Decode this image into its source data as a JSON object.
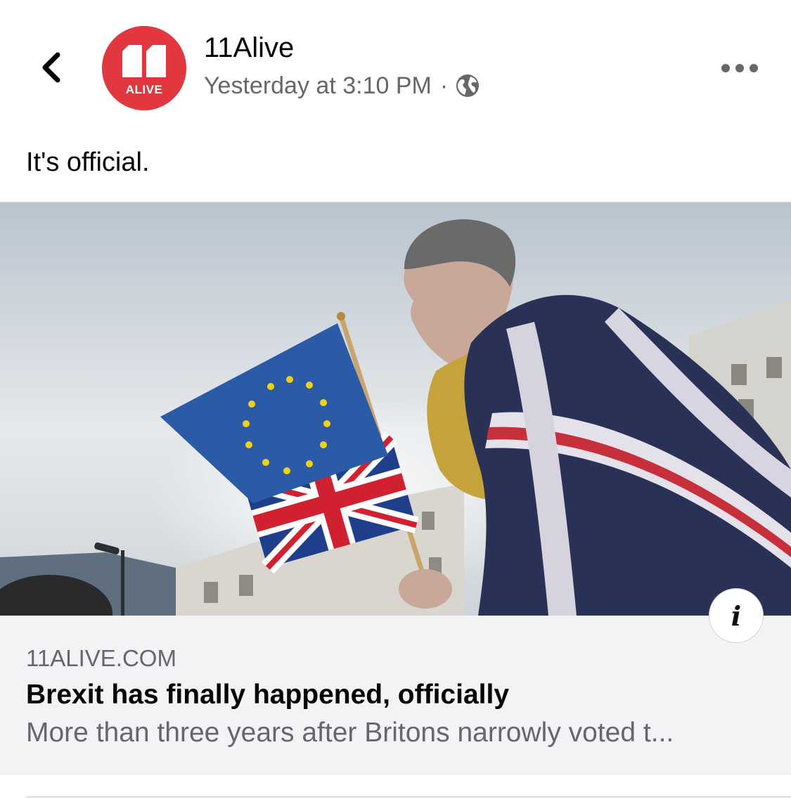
{
  "post": {
    "author": "11Alive",
    "timestamp": "Yesterday at 3:10 PM",
    "separator": "·",
    "privacy_icon": "globe-icon",
    "text": "It's official."
  },
  "avatar": {
    "logo_text": "ALIVE",
    "brand_color": "#e0383e"
  },
  "link_preview": {
    "domain": "11ALIVE.COM",
    "headline": "Brexit has finally happened, officially",
    "description": "More than three years after Britons narrowly voted t...",
    "info_label": "i"
  },
  "icons": {
    "back": "chevron-left-icon",
    "more": "more-horizontal-icon",
    "info": "info-icon"
  },
  "colors": {
    "secondary_text": "#65676b",
    "card_background": "#f2f3f5"
  }
}
